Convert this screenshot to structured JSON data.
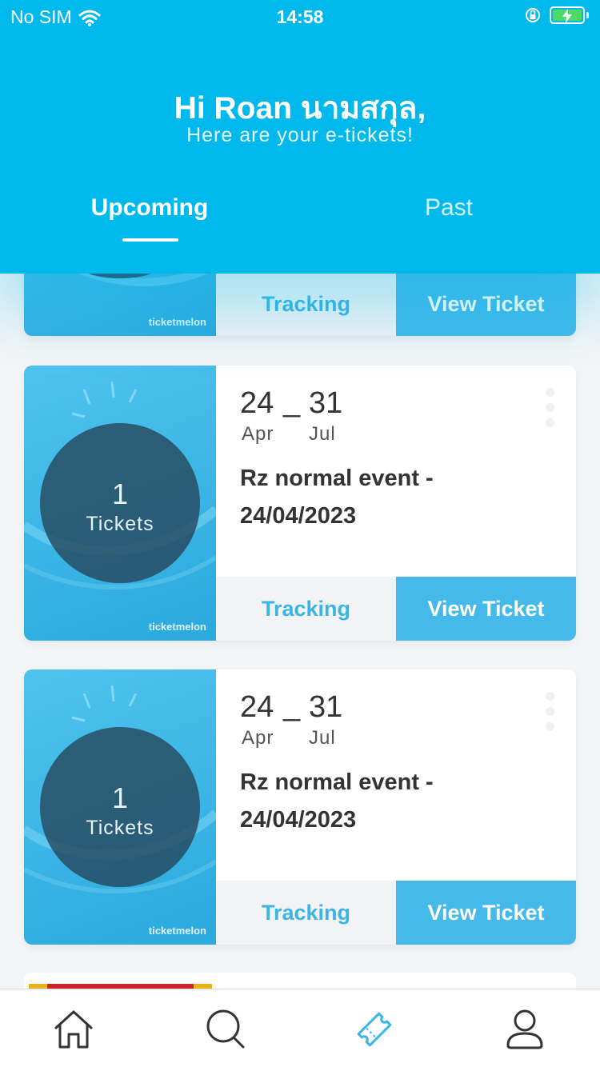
{
  "status_bar": {
    "carrier": "No SIM",
    "time": "14:58",
    "wifi_icon": "wifi-icon",
    "lock_icon": "rotation-lock-icon",
    "battery_icon": "battery-charging-icon"
  },
  "header": {
    "greeting": "Hi Roan นามสกุล,",
    "subtitle": "Here are your e-tickets!"
  },
  "tabs": [
    {
      "label": "Upcoming",
      "active": true
    },
    {
      "label": "Past",
      "active": false
    }
  ],
  "top_partial_card": {
    "brand": "ticketmelon",
    "tracking_label": "Tracking",
    "view_label": "View Ticket"
  },
  "tickets": [
    {
      "count": "1",
      "unit": "Tickets",
      "brand": "ticketmelon",
      "start_day": "24",
      "start_month": "Apr",
      "separator": "_",
      "end_day": "31",
      "end_month": "Jul",
      "title": "Rz normal event - 24/04/2023",
      "tracking_label": "Tracking",
      "view_label": "View Ticket"
    },
    {
      "count": "1",
      "unit": "Tickets",
      "brand": "ticketmelon",
      "start_day": "24",
      "start_month": "Apr",
      "separator": "_",
      "end_day": "31",
      "end_month": "Jul",
      "title": "Rz normal event - 24/04/2023",
      "tracking_label": "Tracking",
      "view_label": "View Ticket"
    }
  ],
  "bottom_nav": [
    {
      "icon": "home-icon",
      "active": false
    },
    {
      "icon": "search-icon",
      "active": false
    },
    {
      "icon": "ticket-icon",
      "active": true
    },
    {
      "icon": "profile-icon",
      "active": false
    }
  ],
  "colors": {
    "header_bg": "#00b9ec",
    "accent": "#44b9ea",
    "tracking_text": "#3bb4e6",
    "nav_active": "#3bb4e6",
    "nav_inactive": "#333333"
  }
}
